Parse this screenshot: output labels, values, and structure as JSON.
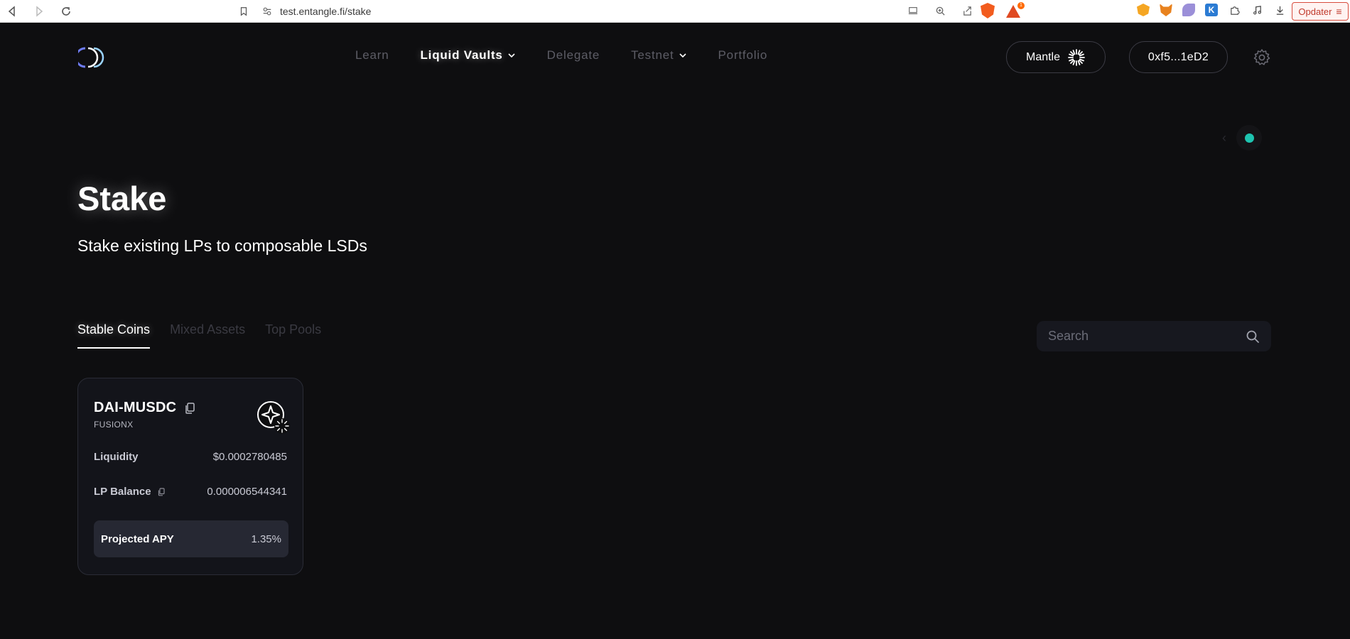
{
  "browser": {
    "url": "test.entangle.fi/stake",
    "updater_label": "Opdater",
    "notification_count": "1"
  },
  "header": {
    "nav": [
      {
        "label": "Learn",
        "active": false
      },
      {
        "label": "Liquid Vaults",
        "active": true
      },
      {
        "label": "Delegate",
        "active": false
      },
      {
        "label": "Testnet",
        "active": false
      },
      {
        "label": "Portfolio",
        "active": false
      }
    ],
    "network_label": "Mantle",
    "wallet_label": "0xf5...1eD2"
  },
  "hero": {
    "title": "Stake",
    "subtitle": "Stake existing LPs to composable LSDs"
  },
  "tabs": [
    {
      "label": "Stable Coins",
      "active": true
    },
    {
      "label": "Mixed Assets",
      "active": false
    },
    {
      "label": "Top Pools",
      "active": false
    }
  ],
  "search": {
    "placeholder": "Search",
    "value": ""
  },
  "pool_card": {
    "name": "DAI-MUSDC",
    "protocol": "FUSIONX",
    "liquidity_label": "Liquidity",
    "liquidity_value": "$0.0002780485",
    "lp_balance_label": "LP Balance",
    "lp_balance_value": "0.000006544341",
    "apy_label": "Projected APY",
    "apy_value": "1.35%"
  },
  "colors": {
    "background": "#0e0e10",
    "card": "#13141a",
    "accent_teal": "#1ec4b0"
  }
}
